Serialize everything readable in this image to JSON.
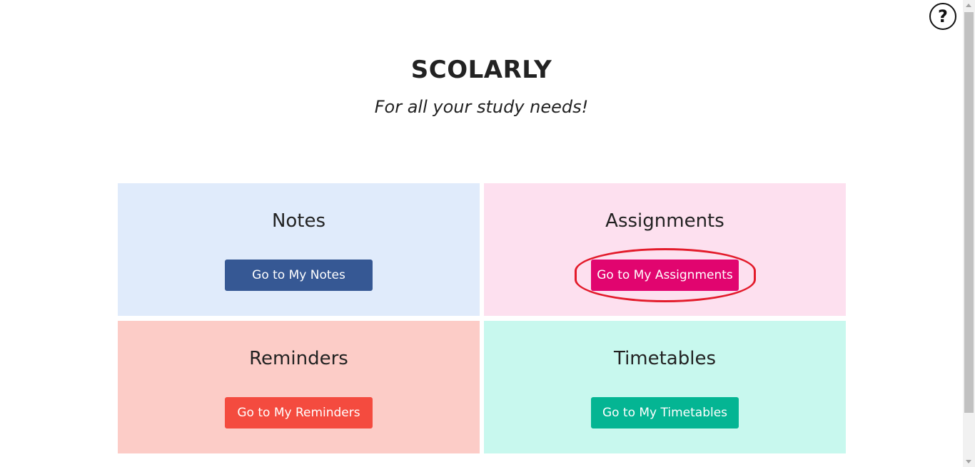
{
  "header": {
    "title": "SCOLARLY",
    "subtitle": "For all your study needs!"
  },
  "help": {
    "icon": "question-circle-icon",
    "label": "?"
  },
  "cards": [
    {
      "title": "Notes",
      "button": "Go to My Notes",
      "bg": "#e0ebfb",
      "accent": "#365894"
    },
    {
      "title": "Assignments",
      "button": "Go to My Assignments",
      "bg": "#fde0ef",
      "accent": "#e1056f"
    },
    {
      "title": "Reminders",
      "button": "Go to My Reminders",
      "bg": "#fcccc7",
      "accent": "#f44b3f"
    },
    {
      "title": "Timetables",
      "button": "Go to My Timetables",
      "bg": "#c8f8ee",
      "accent": "#04b593"
    }
  ],
  "annotation": {
    "highlight_color": "#e31b2b",
    "highlighted_button": "Go to My Assignments"
  }
}
